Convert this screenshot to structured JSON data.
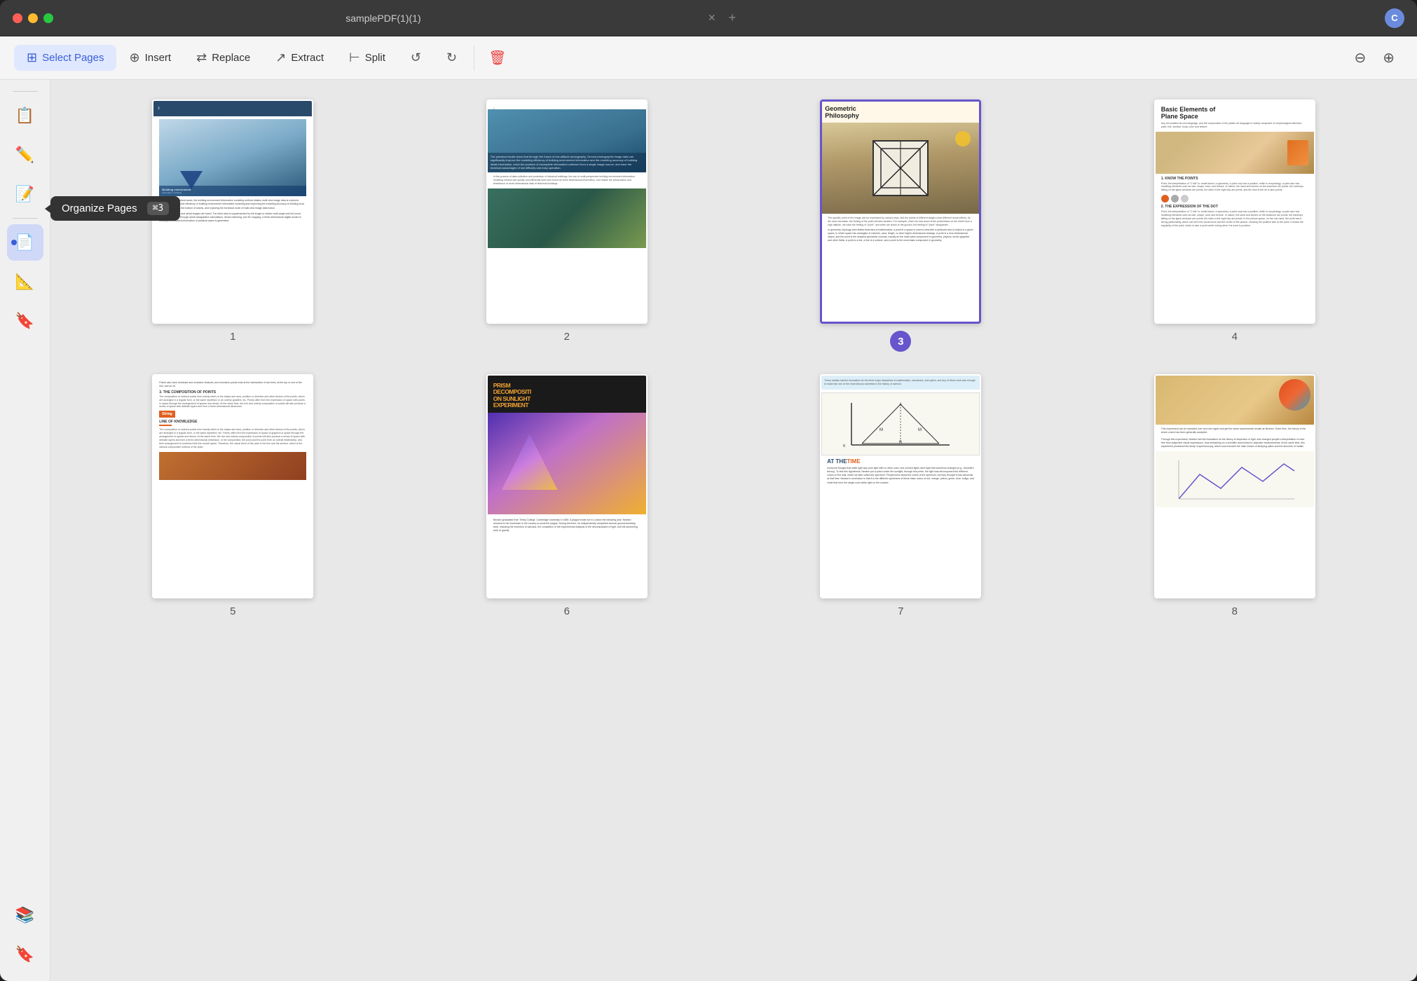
{
  "window": {
    "title": "samplePDF(1)(1)",
    "close_icon": "✕",
    "add_icon": "+",
    "avatar_label": "C"
  },
  "toolbar": {
    "select_pages_label": "Select Pages",
    "insert_label": "Insert",
    "replace_label": "Replace",
    "extract_label": "Extract",
    "split_label": "Split",
    "trash_icon": "🗑",
    "zoom_out_icon": "−",
    "zoom_in_icon": "+"
  },
  "sidebar": {
    "items": [
      {
        "icon": "📋",
        "name": "pages",
        "label": "Pages"
      },
      {
        "icon": "✏️",
        "name": "annotate",
        "label": "Annotate"
      },
      {
        "icon": "📝",
        "name": "edit",
        "label": "Edit"
      },
      {
        "icon": "📐",
        "name": "measure",
        "label": "Measure"
      },
      {
        "icon": "🔖",
        "name": "forms",
        "label": "Forms"
      },
      {
        "icon": "📚",
        "name": "layers",
        "label": "Layers"
      },
      {
        "icon": "🔖",
        "name": "bookmark",
        "label": "Bookmark"
      }
    ]
  },
  "tooltip": {
    "label": "Organize Pages",
    "shortcut": "⌘3"
  },
  "pages": [
    {
      "number": 1,
      "selected": false,
      "label": "1"
    },
    {
      "number": 2,
      "selected": false,
      "label": "2"
    },
    {
      "number": 3,
      "selected": true,
      "label": "3"
    },
    {
      "number": 4,
      "selected": false,
      "label": "4"
    },
    {
      "number": 5,
      "selected": false,
      "label": "5"
    },
    {
      "number": 6,
      "selected": false,
      "label": "6"
    },
    {
      "number": 7,
      "selected": false,
      "label": "7"
    },
    {
      "number": 8,
      "selected": false,
      "label": "8"
    }
  ]
}
